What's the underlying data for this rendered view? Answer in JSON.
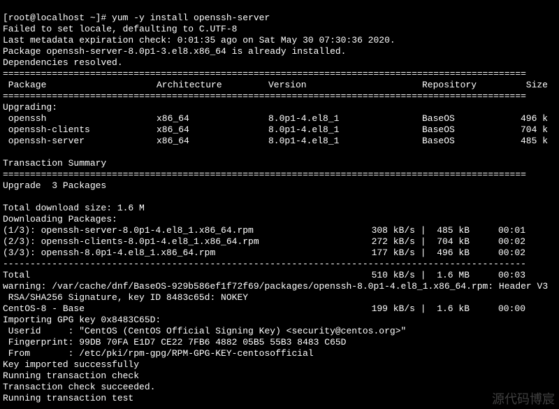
{
  "prompt": "[root@localhost ~]# ",
  "command": "yum -y install openssh-server",
  "preamble": [
    "Failed to set locale, defaulting to C.UTF-8",
    "Last metadata expiration check: 0:01:35 ago on Sat May 30 07:30:36 2020.",
    "Package openssh-server-8.0p1-3.el8.x86_64 is already installed.",
    "Dependencies resolved."
  ],
  "divider_eq": "================================================================================================",
  "divider_dash": "------------------------------------------------------------------------------------------------",
  "headers": {
    "pkg": " Package",
    "arch": "Architecture",
    "ver": "Version",
    "repo": "Repository",
    "size": "Size"
  },
  "upgrading_label": "Upgrading:",
  "packages": [
    {
      "name": " openssh",
      "arch": "x86_64",
      "ver": "8.0p1-4.el8_1",
      "repo": "BaseOS",
      "size": "496 k"
    },
    {
      "name": " openssh-clients",
      "arch": "x86_64",
      "ver": "8.0p1-4.el8_1",
      "repo": "BaseOS",
      "size": "704 k"
    },
    {
      "name": " openssh-server",
      "arch": "x86_64",
      "ver": "8.0p1-4.el8_1",
      "repo": "BaseOS",
      "size": "485 k"
    }
  ],
  "txn_summary": "Transaction Summary",
  "upgrade_count": "Upgrade  3 Packages",
  "total_dl": "Total download size: 1.6 M",
  "dl_label": "Downloading Packages:",
  "downloads": [
    {
      "name": "(1/3): openssh-server-8.0p1-4.el8_1.x86_64.rpm",
      "rate": "308 kB/s",
      "size": "485 kB",
      "time": "00:01"
    },
    {
      "name": "(2/3): openssh-clients-8.0p1-4.el8_1.x86_64.rpm",
      "rate": "272 kB/s",
      "size": "704 kB",
      "time": "00:02"
    },
    {
      "name": "(3/3): openssh-8.0p1-4.el8_1.x86_64.rpm",
      "rate": "177 kB/s",
      "size": "496 kB",
      "time": "00:02"
    }
  ],
  "total_row": {
    "name": "Total",
    "rate": "510 kB/s",
    "size": "1.6 MB",
    "time": "00:03"
  },
  "warning1": "warning: /var/cache/dnf/BaseOS-929b586ef1f72f69/packages/openssh-8.0p1-4.el8_1.x86_64.rpm: Header V3",
  "warning2": " RSA/SHA256 Signature, key ID 8483c65d: NOKEY",
  "centos_row": {
    "name": "CentOS-8 - Base",
    "rate": "199 kB/s",
    "size": "1.6 kB",
    "time": "00:00"
  },
  "gpg": [
    "Importing GPG key 0x8483C65D:",
    " Userid     : \"CentOS (CentOS Official Signing Key) <security@centos.org>\"",
    " Fingerprint: 99DB 70FA E1D7 CE22 7FB6 4882 05B5 55B3 8483 C65D",
    " From       : /etc/pki/rpm-gpg/RPM-GPG-KEY-centosofficial"
  ],
  "tail": [
    "Key imported successfully",
    "Running transaction check",
    "Transaction check succeeded.",
    "Running transaction test"
  ],
  "watermark": "源代码博宸"
}
